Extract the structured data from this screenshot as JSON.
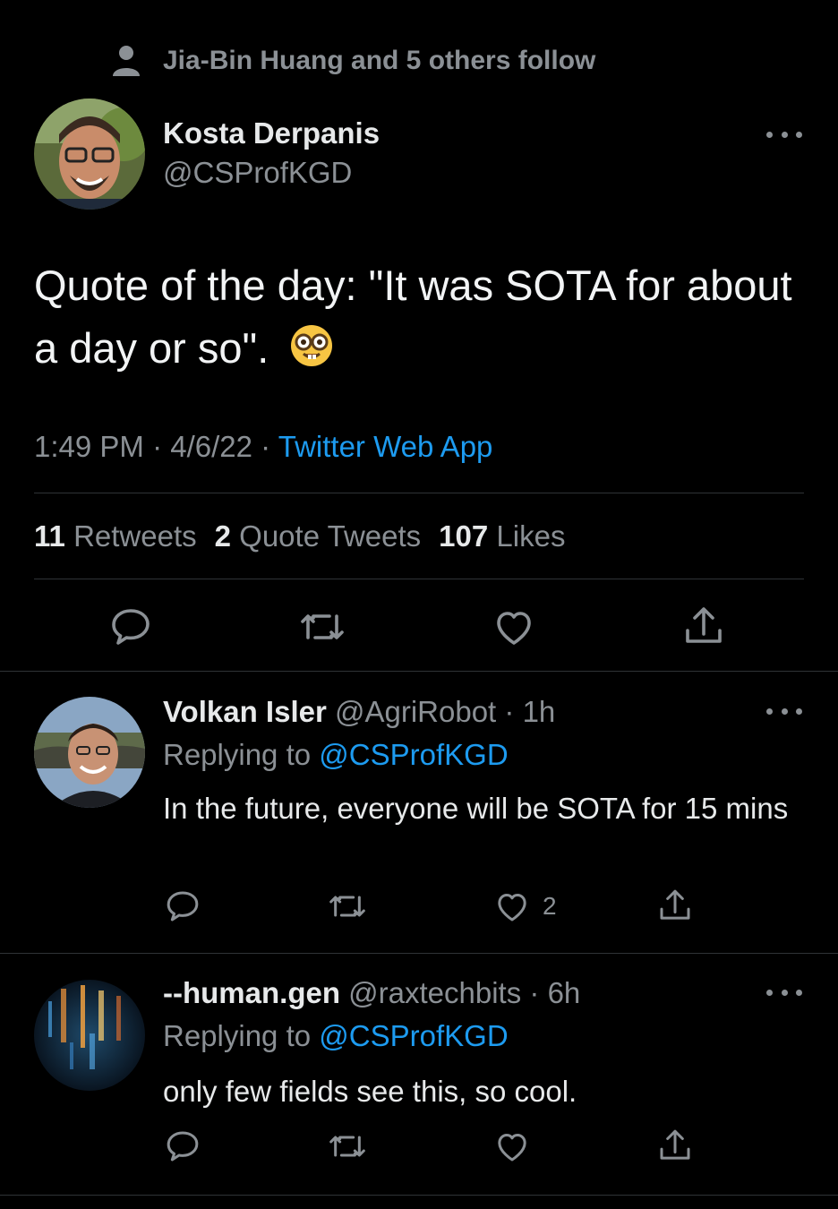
{
  "social_context": {
    "text": "Jia-Bin Huang and 5 others follow"
  },
  "tweet": {
    "author_name": "Kosta Derpanis",
    "author_handle": "@CSProfKGD",
    "text": "Quote of the day: \"It was SOTA for about a day or so\".",
    "emoji": "nerd-face-emoji",
    "time": "1:49 PM",
    "date": "4/6/22",
    "source": "Twitter Web App",
    "stats": {
      "retweets_count": "11",
      "retweets_label": "Retweets",
      "quotes_count": "2",
      "quotes_label": "Quote Tweets",
      "likes_count": "107",
      "likes_label": "Likes"
    }
  },
  "replies": [
    {
      "name": "Volkan Isler",
      "handle": "@AgriRobot",
      "time": "1h",
      "replying_label": "Replying to",
      "replying_to": "@CSProfKGD",
      "text": "In the future, everyone will be SOTA for 15 mins",
      "likes": "2"
    },
    {
      "name": "--human.gen",
      "handle": "@raxtechbits",
      "time": "6h",
      "replying_label": "Replying to",
      "replying_to": "@CSProfKGD",
      "text": "only few fields see this, so cool.",
      "likes": ""
    }
  ],
  "icons": {
    "reply": "reply-icon",
    "retweet": "retweet-icon",
    "like": "heart-icon",
    "share": "share-icon",
    "more": "more-icon",
    "person": "person-icon"
  },
  "colors": {
    "background": "#000000",
    "text": "#e7e9ea",
    "muted": "#71767b",
    "accent": "#1d9bf0",
    "divider": "#2f3336"
  }
}
